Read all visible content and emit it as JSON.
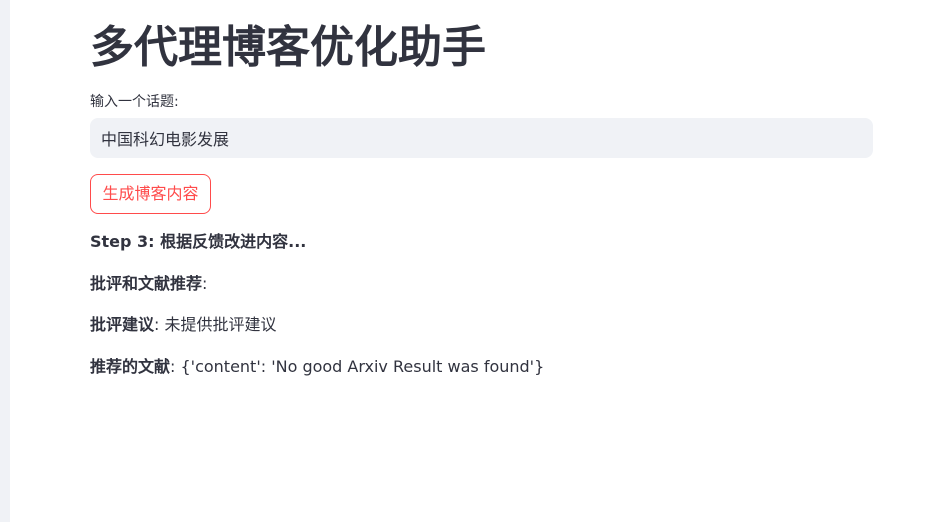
{
  "app": {
    "title": "多代理博客优化助手"
  },
  "form": {
    "input_label": "输入一个话题:",
    "input_value": "中国科幻电影发展",
    "button_label": "生成博客内容"
  },
  "output": {
    "step_text": "Step 3: 根据反馈改进内容...",
    "critique_heading": "批评和文献推荐",
    "critique_suffix": ":",
    "suggestion_label": "批评建议",
    "suggestion_value": ": 未提供批评建议",
    "references_label": "推荐的文献",
    "references_value": ": {'content': 'No good Arxiv Result was found'}"
  },
  "colors": {
    "accent": "#ff4b4b",
    "text": "#31333f",
    "input_bg": "#f0f2f6"
  }
}
